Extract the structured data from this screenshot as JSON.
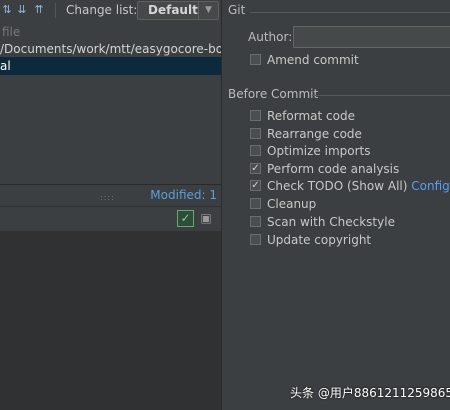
{
  "left_panel": {
    "change_list_label": "Change list:",
    "change_list_value": "Default",
    "tree_rows": [
      "file",
      "/Documents/work/mtt/easygocore-bo",
      "al"
    ],
    "modified_text": "Modified: 1"
  },
  "right_panel": {
    "git_title": "Git",
    "author_label": "Author:",
    "author_value": "",
    "amend": {
      "label": "Amend commit",
      "checked": false
    },
    "before_commit_title": "Before Commit",
    "options": [
      {
        "label": "Reformat code",
        "checked": false
      },
      {
        "label": "Rearrange code",
        "checked": false
      },
      {
        "label": "Optimize imports",
        "checked": false
      },
      {
        "label": "Perform code analysis",
        "checked": true
      },
      {
        "label": "Check TODO (Show All)",
        "checked": true,
        "link": "Configure"
      },
      {
        "label": "Cleanup",
        "checked": false
      },
      {
        "label": "Scan with Checkstyle",
        "checked": false
      },
      {
        "label": "Update copyright",
        "checked": false
      }
    ]
  },
  "watermark": "头条 @用户8861211259865",
  "colors": {
    "background": "#3c3f41",
    "selection": "#0d293e",
    "link": "#589df6",
    "modified": "#5c9fd6"
  }
}
